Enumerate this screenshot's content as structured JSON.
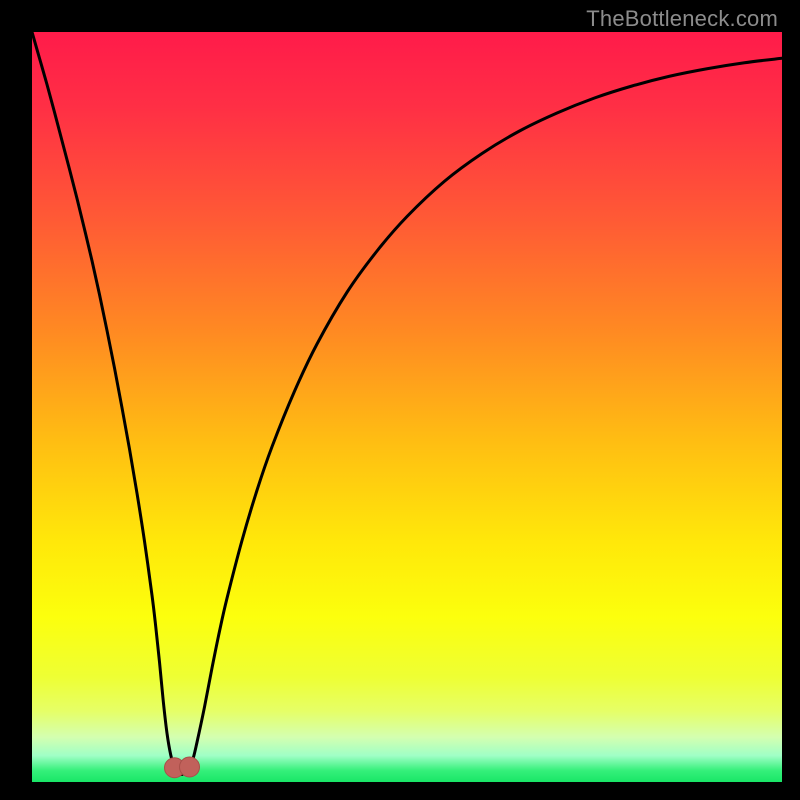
{
  "watermark": "TheBottleneck.com",
  "colors": {
    "frame": "#000000",
    "curve": "#000000",
    "marker_fill": "#c1615b",
    "marker_stroke": "#a84f49",
    "watermark": "#8c8c8c",
    "gradient_stops": [
      {
        "offset": 0.0,
        "color": "#ff1b4a"
      },
      {
        "offset": 0.1,
        "color": "#ff2f45"
      },
      {
        "offset": 0.25,
        "color": "#ff5a35"
      },
      {
        "offset": 0.4,
        "color": "#ff8a22"
      },
      {
        "offset": 0.55,
        "color": "#ffbf12"
      },
      {
        "offset": 0.68,
        "color": "#ffe80a"
      },
      {
        "offset": 0.78,
        "color": "#fcff0d"
      },
      {
        "offset": 0.86,
        "color": "#eeff34"
      },
      {
        "offset": 0.905,
        "color": "#e6ff66"
      },
      {
        "offset": 0.94,
        "color": "#d4ffb0"
      },
      {
        "offset": 0.965,
        "color": "#9fffc6"
      },
      {
        "offset": 0.985,
        "color": "#34f07a"
      },
      {
        "offset": 1.0,
        "color": "#19e667"
      }
    ]
  },
  "chart_data": {
    "type": "line",
    "title": "",
    "xlabel": "",
    "ylabel": "",
    "xlim": [
      0,
      100
    ],
    "ylim": [
      0,
      100
    ],
    "grid": false,
    "x": [
      0,
      1,
      2,
      3,
      4,
      5,
      6,
      7,
      8,
      9,
      10,
      11,
      12,
      13,
      14,
      15,
      16,
      16.5,
      17,
      17.5,
      18,
      18.5,
      19,
      19.5,
      20,
      20.5,
      21,
      21.5,
      22,
      23,
      24,
      25,
      26,
      28,
      30,
      32,
      35,
      38,
      42,
      46,
      50,
      55,
      60,
      65,
      70,
      75,
      80,
      85,
      90,
      95,
      100
    ],
    "values": [
      100,
      96.5,
      93,
      89.3,
      85.5,
      81.7,
      77.8,
      73.7,
      69.5,
      65.0,
      60.2,
      55.2,
      49.9,
      44.4,
      38.5,
      32.1,
      24.9,
      20.7,
      16.0,
      10.8,
      6.5,
      3.6,
      1.9,
      1.2,
      1.0,
      1.3,
      2.0,
      3.2,
      5.3,
      10.0,
      15.2,
      20.1,
      24.5,
      32.2,
      38.9,
      44.7,
      52.1,
      58.4,
      65.3,
      70.8,
      75.4,
      80.1,
      83.8,
      86.8,
      89.2,
      91.2,
      92.8,
      94.1,
      95.1,
      95.9,
      96.5
    ],
    "marker_points": [
      {
        "x": 19.0,
        "y": 1.9
      },
      {
        "x": 21.0,
        "y": 2.0
      }
    ],
    "legend": null
  }
}
